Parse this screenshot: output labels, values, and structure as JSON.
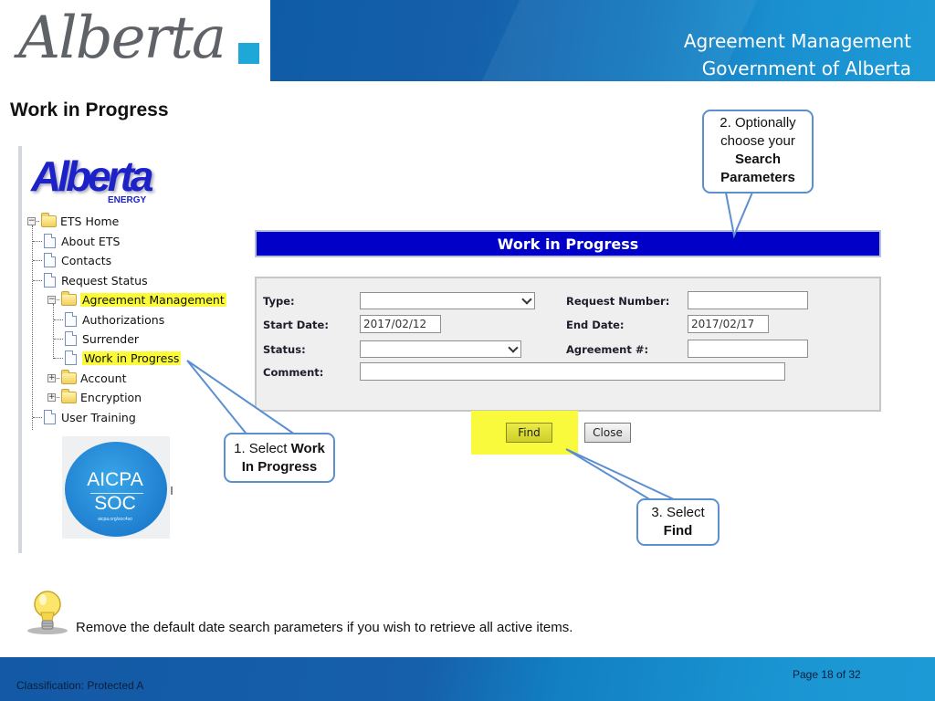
{
  "header": {
    "logo_text": "Alberta",
    "banner_line1": "Agreement Management",
    "banner_line2": "Government of Alberta"
  },
  "page_title": "Work in Progress",
  "nav": {
    "logo_main": "Alberta",
    "logo_sub": "ENERGY",
    "tree": [
      {
        "label": "ETS Home",
        "type": "folder",
        "expander": "minus"
      },
      {
        "label": "About ETS",
        "type": "page"
      },
      {
        "label": "Contacts",
        "type": "page"
      },
      {
        "label": "Request Status",
        "type": "page"
      },
      {
        "label": "Agreement Management",
        "type": "folder",
        "expander": "minus",
        "highlighted": true
      },
      {
        "label": "Authorizations",
        "type": "page"
      },
      {
        "label": "Surrender",
        "type": "page"
      },
      {
        "label": "Work in Progress",
        "type": "page",
        "highlighted": true
      },
      {
        "label": "Account",
        "type": "folder",
        "expander": "plus"
      },
      {
        "label": "Encryption",
        "type": "folder",
        "expander": "plus"
      },
      {
        "label": "User Training",
        "type": "page"
      }
    ],
    "badge": {
      "line1": "AICPA",
      "line2": "SOC",
      "line3": "aicpa.org/soc4so"
    }
  },
  "form": {
    "title": "Work in Progress",
    "fields": {
      "type_label": "Type:",
      "type_value": "",
      "request_number_label": "Request Number:",
      "request_number_value": "",
      "start_date_label": "Start Date:",
      "start_date_value": "2017/02/12",
      "end_date_label": "End Date:",
      "end_date_value": "2017/02/17",
      "status_label": "Status:",
      "status_value": "",
      "agreement_label": "Agreement #:",
      "agreement_value": "",
      "comment_label": "Comment:",
      "comment_value": ""
    },
    "find_label": "Find",
    "close_label": "Close"
  },
  "callouts": {
    "step1_prefix": "1. Select ",
    "step1_bold1": "Work",
    "step1_bold2": "In Progress",
    "step2_line1": "2. Optionally",
    "step2_line2": "choose your",
    "step2_bold1": "Search",
    "step2_bold2": "Parameters",
    "step3_line1": "3. Select",
    "step3_bold": "Find"
  },
  "tip": "Remove the default date search parameters if you wish to retrieve all active items.",
  "footer": {
    "classification": "Classification: Protected A",
    "page": "Page 18 of 32"
  },
  "colors": {
    "form_header": "#0000c8",
    "highlight": "#fafa3c",
    "callout_border": "#5b8fd0",
    "banner": "#165faa"
  }
}
